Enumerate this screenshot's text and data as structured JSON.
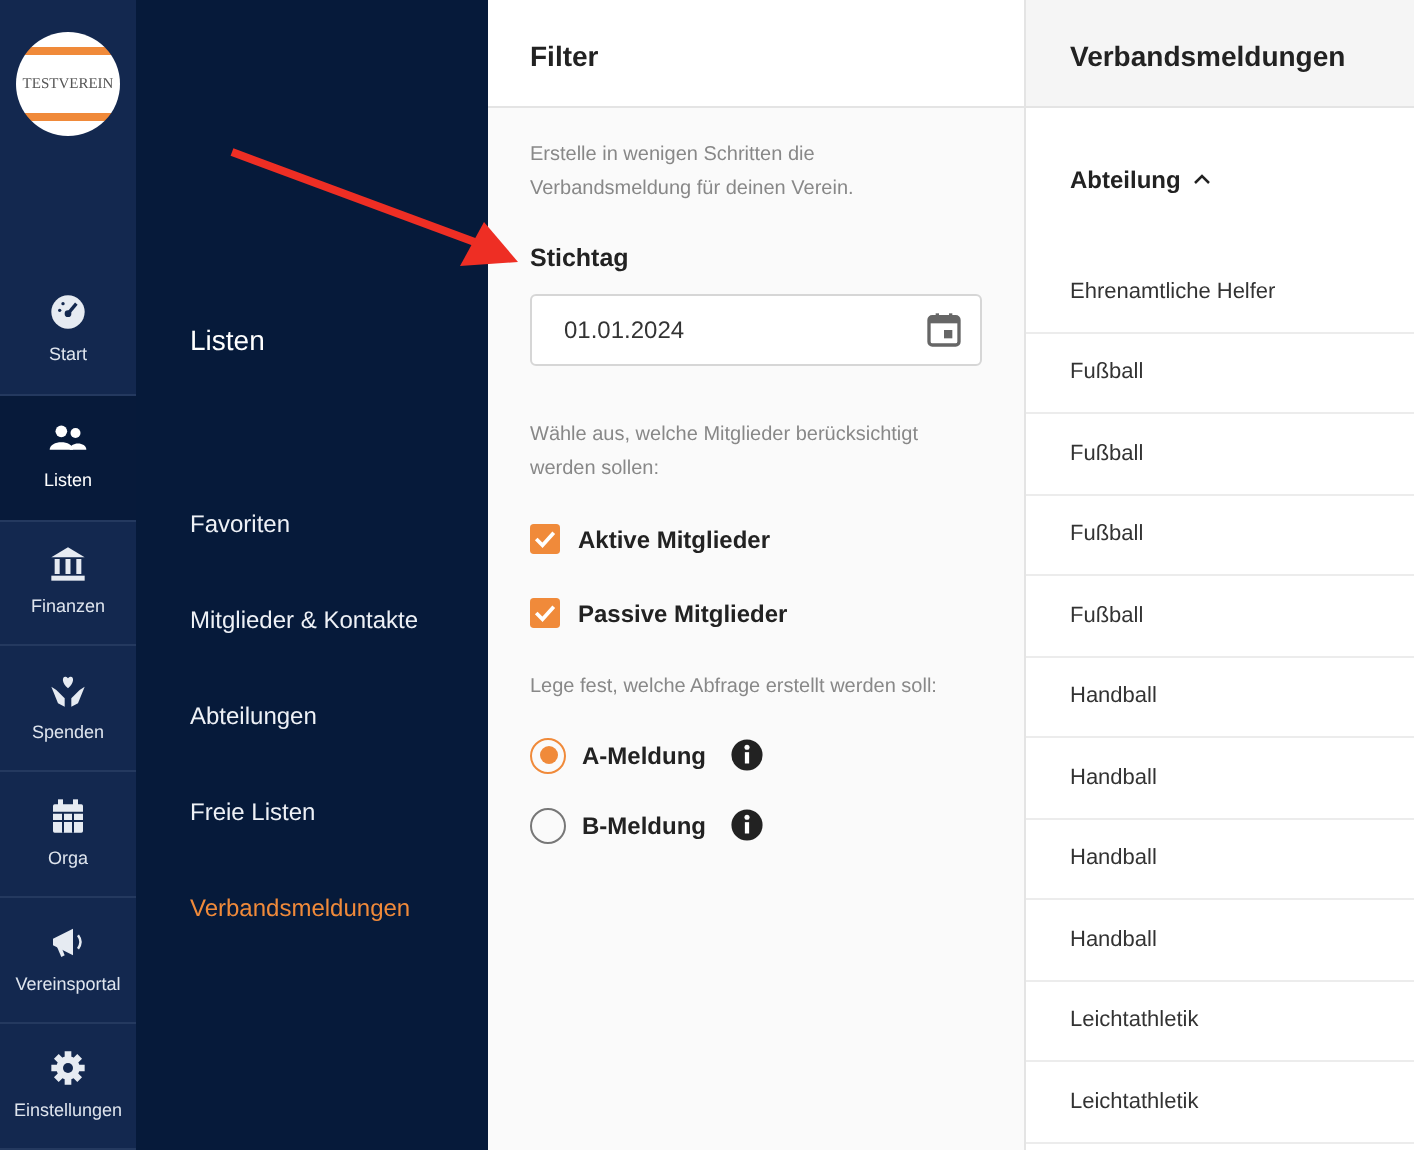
{
  "logo": {
    "text": "TESTVEREIN"
  },
  "rail": [
    {
      "kind": "gauge",
      "label": "Start",
      "selected": false
    },
    {
      "kind": "people",
      "label": "Listen",
      "selected": true
    },
    {
      "kind": "bank",
      "label": "Finanzen",
      "selected": false
    },
    {
      "kind": "heart",
      "label": "Spenden",
      "selected": false
    },
    {
      "kind": "calendar",
      "label": "Orga",
      "selected": false
    },
    {
      "kind": "megaphone",
      "label": "Vereinsportal",
      "selected": false
    },
    {
      "kind": "gear",
      "label": "Einstellungen",
      "selected": false
    }
  ],
  "submenu": {
    "title": "Listen",
    "items": [
      {
        "label": "Favoriten",
        "selected": false
      },
      {
        "label": "Mitglieder & Kontakte",
        "selected": false
      },
      {
        "label": "Abteilungen",
        "selected": false
      },
      {
        "label": "Freie Listen",
        "selected": false
      },
      {
        "label": "Verbandsmeldungen",
        "selected": true
      }
    ]
  },
  "filter": {
    "title": "Filter",
    "intro": "Erstelle in wenigen Schritten die Verbandsmeldung für deinen Verein.",
    "date_label": "Stichtag",
    "date_value": "01.01.2024",
    "members_hint": "Wähle aus, welche Mitglieder berücksichtigt werden sollen:",
    "members": [
      {
        "label": "Aktive Mitglieder",
        "checked": true
      },
      {
        "label": "Passive Mitglieder",
        "checked": true
      }
    ],
    "query_hint": "Lege fest, welche Abfrage erstellt werden soll:",
    "queries": [
      {
        "label": "A-Meldung",
        "selected": true
      },
      {
        "label": "B-Meldung",
        "selected": false
      }
    ]
  },
  "results": {
    "title": "Verbandsmeldungen",
    "column": "Abteilung",
    "rows": [
      "Ehrenamtliche Helfer",
      "Fußball",
      "Fußball",
      "Fußball",
      "Fußball",
      "Handball",
      "Handball",
      "Handball",
      "Handball",
      "Leichtathletik",
      "Leichtathletik"
    ]
  }
}
